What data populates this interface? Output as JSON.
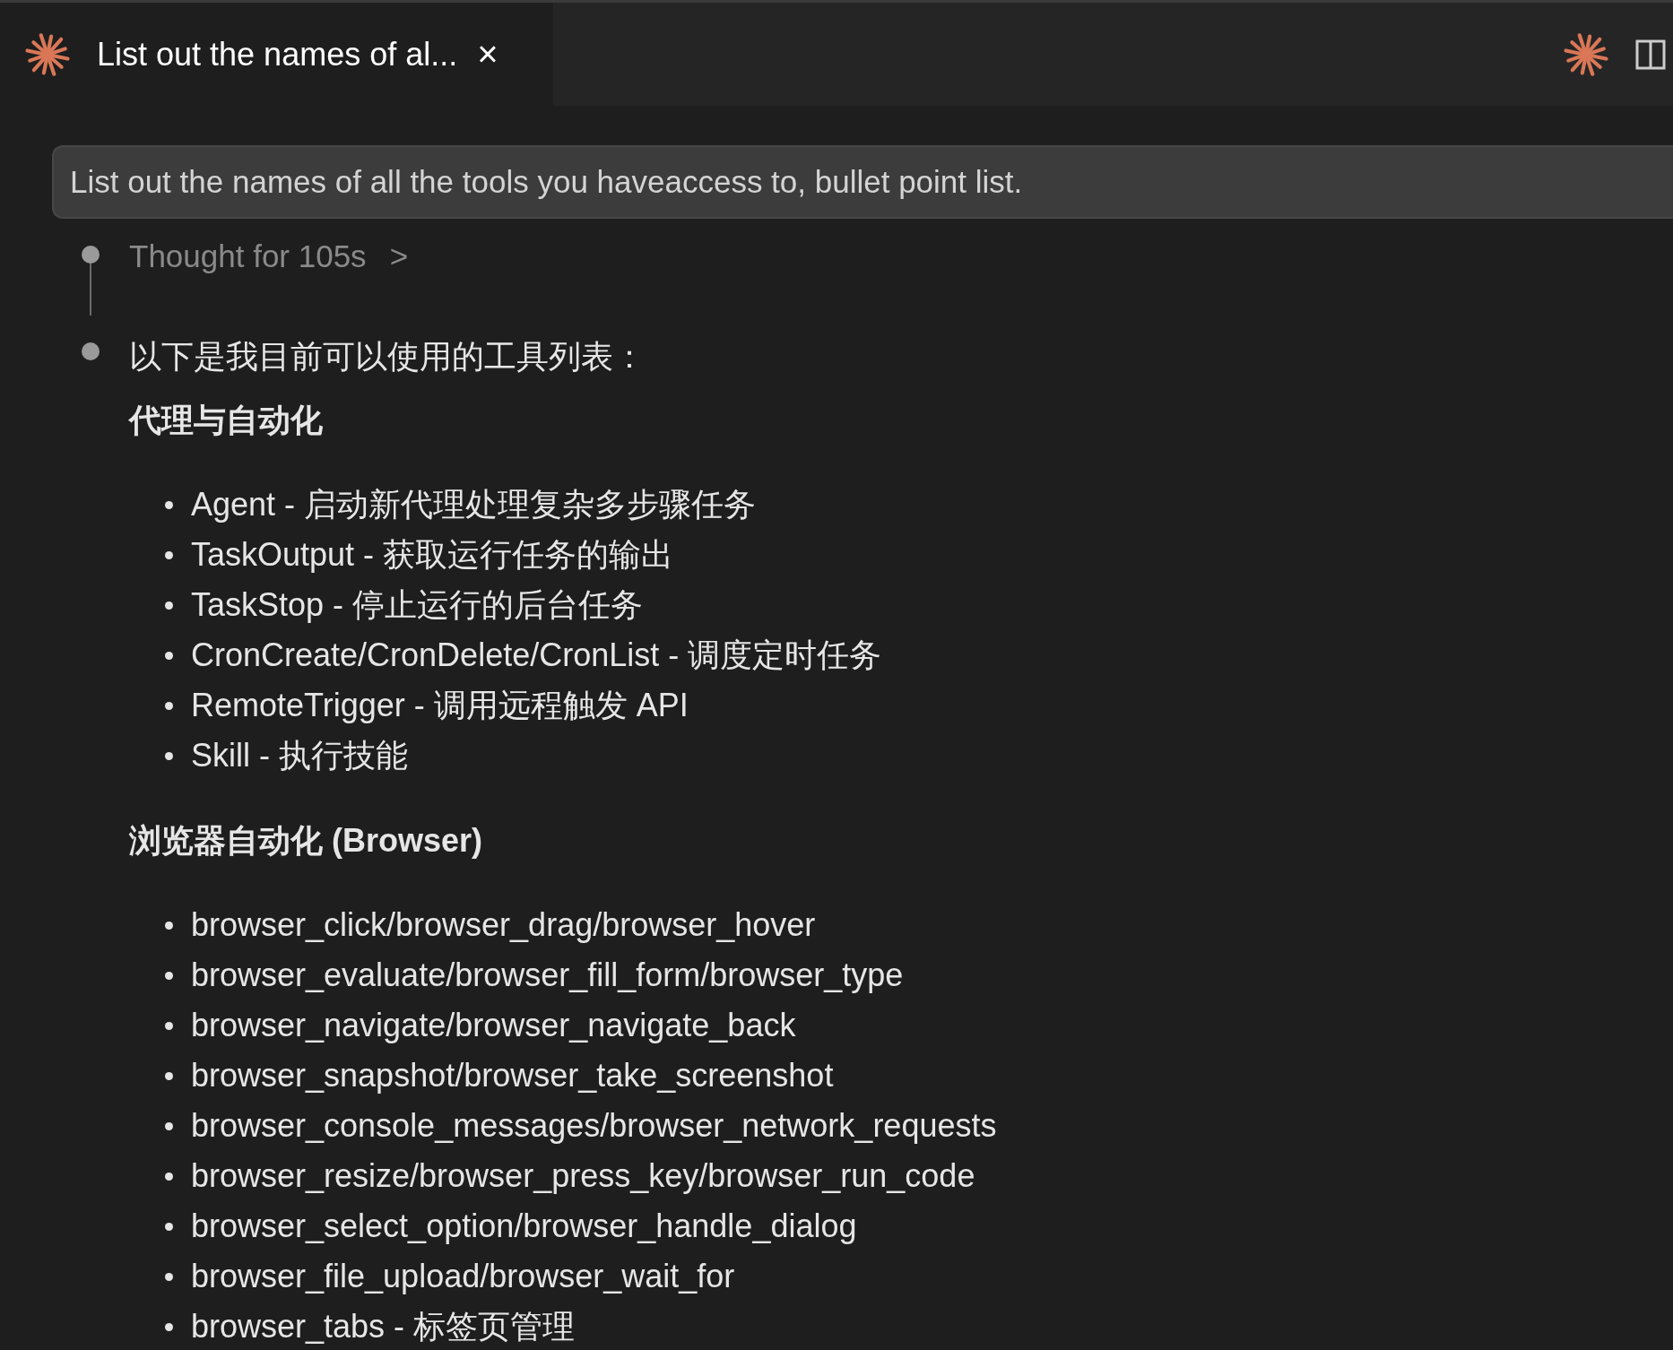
{
  "tab": {
    "title": "List out the names of al...",
    "close": "×",
    "selected": true
  },
  "prompt": "List out the names of all the tools you haveaccess to, bullet point list.",
  "thought": {
    "label": "Thought for 105s",
    "chevron": ">"
  },
  "response": {
    "intro": "以下是我目前可以使用的工具列表：",
    "sections": [
      {
        "heading": "代理与自动化",
        "items": [
          "Agent - 启动新代理处理复杂多步骤任务",
          "TaskOutput - 获取运行任务的输出",
          "TaskStop - 停止运行的后台任务",
          "CronCreate/CronDelete/CronList - 调度定时任务",
          "RemoteTrigger - 调用远程触发 API",
          "Skill - 执行技能"
        ]
      },
      {
        "heading": "浏览器自动化 (Browser)",
        "items": [
          "browser_click/browser_drag/browser_hover",
          "browser_evaluate/browser_fill_form/browser_type",
          "browser_navigate/browser_navigate_back",
          "browser_snapshot/browser_take_screenshot",
          "browser_console_messages/browser_network_requests",
          "browser_resize/browser_press_key/browser_run_code",
          "browser_select_option/browser_handle_dialog",
          "browser_file_upload/browser_wait_for",
          "browser_tabs - 标签页管理"
        ]
      }
    ]
  }
}
